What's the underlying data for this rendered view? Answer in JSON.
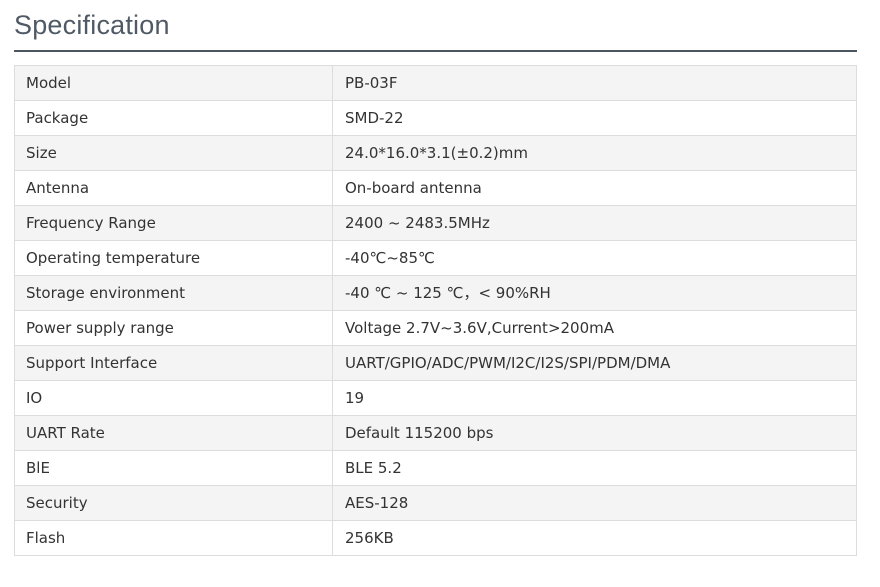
{
  "heading": "Specification",
  "spec_rows": [
    {
      "key": "Model",
      "value": "PB-03F"
    },
    {
      "key": "Package",
      "value": "SMD-22"
    },
    {
      "key": "Size",
      "value": "24.0*16.0*3.1(±0.2)mm"
    },
    {
      "key": "Antenna",
      "value": "On-board antenna"
    },
    {
      "key": "Frequency Range",
      "value": "2400 ~ 2483.5MHz"
    },
    {
      "key": "Operating temperature",
      "value": "-40℃~85℃"
    },
    {
      "key": "Storage environment",
      "value": "-40 ℃ ~ 125 ℃，< 90%RH"
    },
    {
      "key": "Power supply range",
      "value": "Voltage 2.7V~3.6V,Current>200mA"
    },
    {
      "key": "Support Interface",
      "value": "UART/GPIO/ADC/PWM/I2C/I2S/SPI/PDM/DMA"
    },
    {
      "key": "IO",
      "value": "19"
    },
    {
      "key": "UART Rate",
      "value": "Default 115200 bps"
    },
    {
      "key": "BlE",
      "value": "BLE 5.2"
    },
    {
      "key": "Security",
      "value": "AES-128"
    },
    {
      "key": "Flash",
      "value": "256KB"
    }
  ]
}
